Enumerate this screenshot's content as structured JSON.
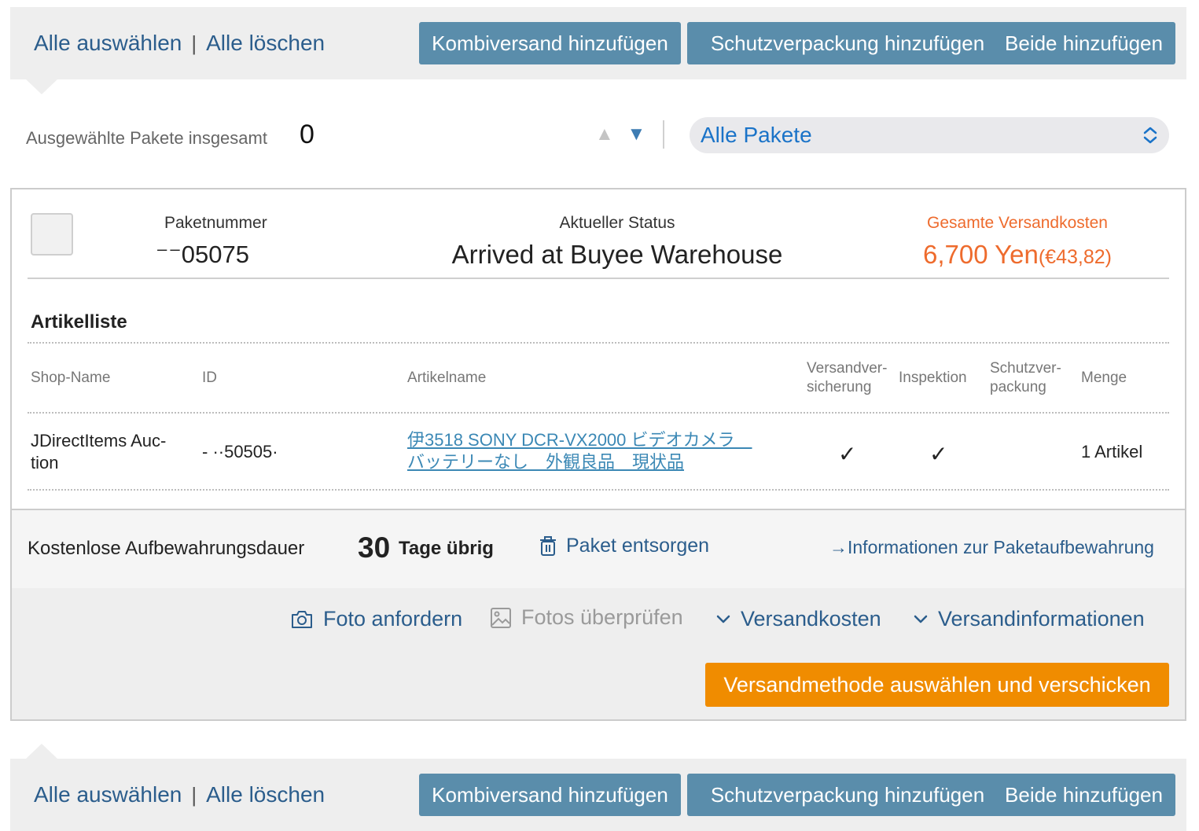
{
  "toolbar": {
    "select_all": "Alle auswählen",
    "separator": "|",
    "clear_all": "Alle löschen",
    "add_combined": "Kombiversand hinzufügen",
    "add_protective": "Schutzverpackung hinzufügen",
    "add_both": "Beide hinzufügen"
  },
  "summary": {
    "total_label": "Ausgewählte Pakete insgesamt",
    "total_value": "0",
    "sort_up": "▲",
    "sort_down": "▼",
    "filter_value": "Alle Pakete"
  },
  "package": {
    "number_label": "Paketnummer",
    "number_value": "⁻⁻05075",
    "status_label": "Aktueller Status",
    "status_value": "Arrived at Buyee Warehouse",
    "cost_label": "Gesamte Versandkosten",
    "cost_yen": "6,700 Yen",
    "cost_eur": "(€43,82)",
    "item_list_title": "Artikelliste",
    "columns": {
      "shop": "Shop-Name",
      "id": "ID",
      "name": "Artikelname",
      "insurance_1": "Versandver-",
      "insurance_2": "sicherung",
      "inspection": "Inspektion",
      "protective_1": "Schutzver-",
      "protective_2": "packung",
      "quantity": "Menge"
    },
    "items": [
      {
        "shop_1": "JDirectItems Auc-",
        "shop_2": "tion",
        "id": "- ··50505·",
        "name_1": "伊3518 SONY DCR-VX2000 ビデオカメラ　",
        "name_2": "バッテリーなし　外観良品　現状品",
        "insurance": "✓",
        "inspection": "✓",
        "quantity": "1 Artikel"
      }
    ]
  },
  "storage": {
    "label": "Kostenlose Aufbewahrungsdauer",
    "days": "30",
    "days_suffix": "Tage übrig",
    "discard": "Paket entsorgen",
    "info_link": "→Informationen zur Paketaufbewahrung"
  },
  "actions": {
    "request_photo": "Foto anfordern",
    "check_photos": "Fotos überprüfen",
    "shipping_cost": "Versandkosten",
    "shipping_info": "Versandinformationen",
    "ship_button": "Versandmethode auswählen und verschicken"
  },
  "colors": {
    "toolbar_button": "#5a8dab",
    "link": "#2b5d8c",
    "accent_orange": "#ee6b2d",
    "ship_button": "#f08c00",
    "bar_bg": "#eeeeee"
  }
}
